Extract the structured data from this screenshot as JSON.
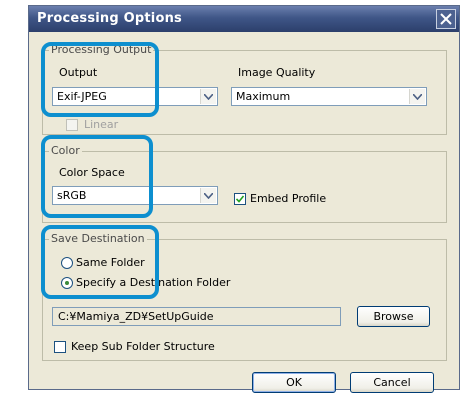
{
  "window": {
    "title": "Processing Options"
  },
  "processing_output": {
    "legend": "Processing Output",
    "output_label": "Output",
    "output_value": "Exif-JPEG",
    "quality_label": "Image Quality",
    "quality_value": "Maximum",
    "linear_label": "Linear",
    "linear_checked": false
  },
  "color": {
    "legend": "Color",
    "space_label": "Color Space",
    "space_value": "sRGB",
    "embed_label": "Embed Profile",
    "embed_checked": true
  },
  "save_destination": {
    "legend": "Save Destination",
    "same_folder_label": "Same Folder",
    "specify_label": "Specify a Destination Folder",
    "selected": "specify",
    "folder_path": "C:¥Mamiya_ZD¥SetUpGuide",
    "browse_label": "Browse",
    "keep_label": "Keep Sub Folder Structure",
    "keep_checked": false
  },
  "footer": {
    "ok_label": "OK",
    "cancel_label": "Cancel"
  },
  "colors": {
    "highlight": "#0d8fcf",
    "titlebar": "#3f5687",
    "dialog_bg": "#ece9d8"
  },
  "icons": [
    "close-icon",
    "chevron-down-icon",
    "checkmark-icon"
  ]
}
